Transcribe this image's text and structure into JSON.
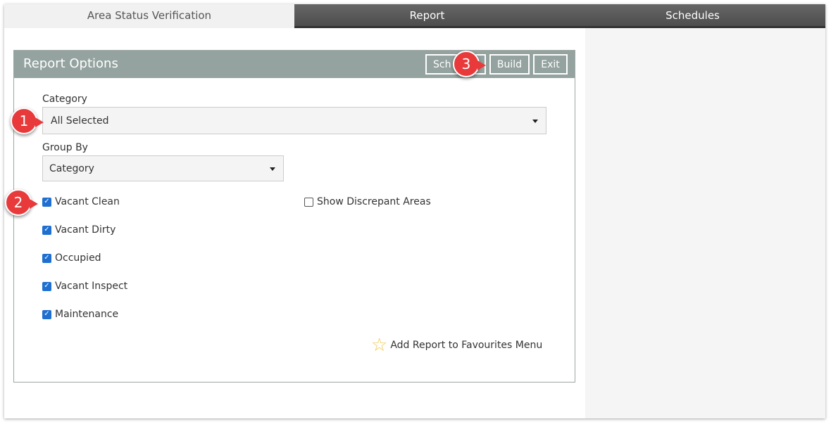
{
  "tabs": [
    {
      "label": "Area Status Verification",
      "active": true
    },
    {
      "label": "Report",
      "active": false
    },
    {
      "label": "Schedules",
      "active": false
    }
  ],
  "panel": {
    "title": "Report Options",
    "buttons": {
      "schedule": "Sch",
      "build": "Build",
      "exit": "Exit"
    }
  },
  "form": {
    "category_label": "Category",
    "category_value": "All Selected",
    "group_by_label": "Group By",
    "group_by_value": "Category",
    "checkboxes": [
      {
        "label": "Vacant Clean",
        "checked": true
      },
      {
        "label": "Vacant Dirty",
        "checked": true
      },
      {
        "label": "Occupied",
        "checked": true
      },
      {
        "label": "Vacant Inspect",
        "checked": true
      },
      {
        "label": "Maintenance",
        "checked": true
      }
    ],
    "show_discrepant": {
      "label": "Show Discrepant Areas",
      "checked": false
    }
  },
  "favourites_link": "Add Report to Favourites Menu",
  "callouts": [
    "1",
    "2",
    "3"
  ],
  "icons": {
    "checkbox_checked": "checkmark-icon",
    "favourite": "star-icon",
    "dropdown": "caret-down-icon"
  },
  "colors": {
    "header": "#94a39f",
    "tab_dark": "#4d4d4d",
    "callout": "#e8393b",
    "checkbox": "#1f6fd1"
  }
}
